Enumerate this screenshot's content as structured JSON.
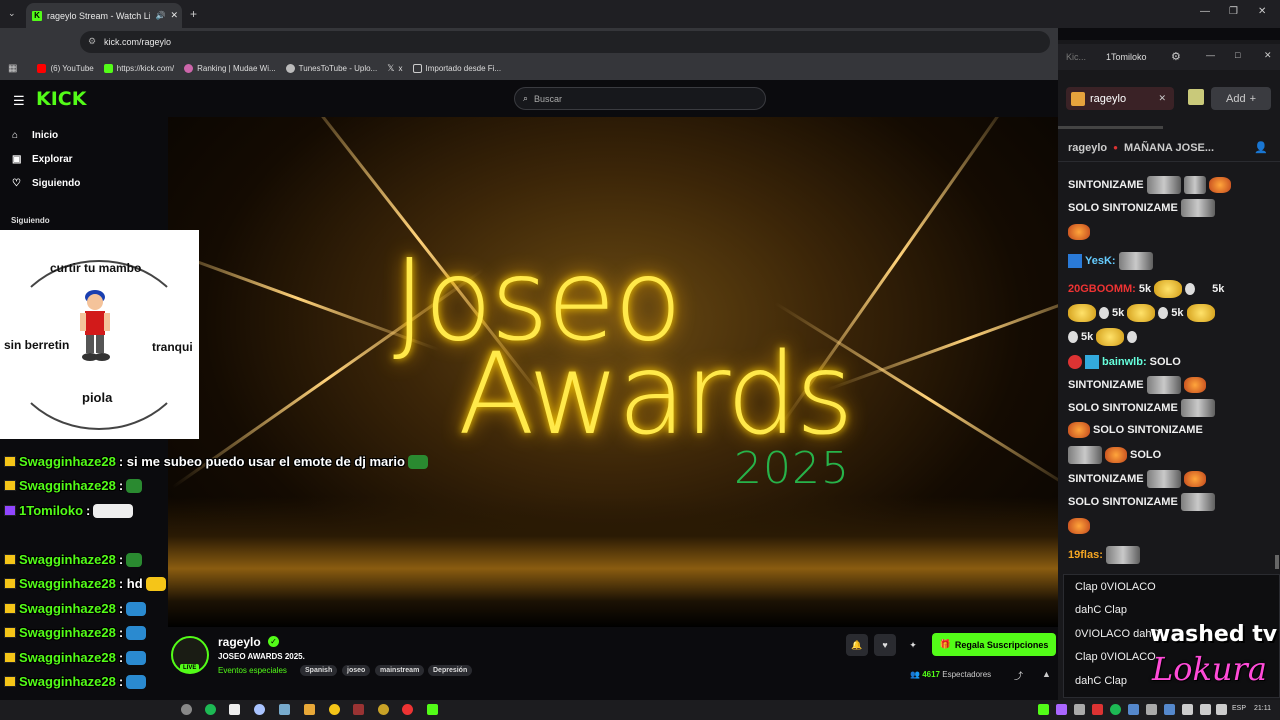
{
  "browser": {
    "tab_title": "rageylo Stream - Watch Liv",
    "url": "kick.com/rageylo",
    "bookmarks": [
      "(6) YouTube",
      "https://kick.com/",
      "Ranking | Mudae Wi...",
      "TunesToTube - Uplo...",
      "x",
      "Importado desde Fi..."
    ]
  },
  "kick": {
    "logo": "KICK",
    "search_placeholder": "Buscar",
    "nav": [
      "Inicio",
      "Explorar",
      "Siguiendo"
    ],
    "following_title": "Siguiendo"
  },
  "video": {
    "title_line1": "Joseo",
    "title_line2": "Awards",
    "year": "2025"
  },
  "mambo": {
    "top": "curtir tu mambo",
    "left": "sin berretin",
    "right": "tranqui",
    "bottom": "piola"
  },
  "overlay_chat": [
    {
      "user": "Swagginhaze28",
      "text": ": si me subeo puedo usar el emote de dj mario"
    },
    {
      "user": "Swagginhaze28",
      "text": ":"
    },
    {
      "user": "1Tomiloko",
      "text": ":"
    },
    {
      "user": "Swagginhaze28",
      "text": ":"
    },
    {
      "user": "Swagginhaze28",
      "text": ": hd"
    },
    {
      "user": "Swagginhaze28",
      "text": ":"
    },
    {
      "user": "Swagginhaze28",
      "text": ":"
    },
    {
      "user": "Swagginhaze28",
      "text": ":"
    },
    {
      "user": "Swagginhaze28",
      "text": ":"
    },
    {
      "user": "Swagginhaze28",
      "text": ":"
    }
  ],
  "stream": {
    "streamer": "rageylo",
    "title": "JOSEO AWARDS 2025.",
    "category": "Eventos especiales",
    "tags": [
      "Spanish",
      "joseo",
      "mainstream",
      "Depresión"
    ],
    "live_label": "LIVE",
    "subscribe_label": "Regala Suscripciones",
    "viewers_count": "4617",
    "viewers_label": "Espectadores"
  },
  "right_panel": {
    "window_title": "1Tomiloko",
    "channel_tab": "rageylo",
    "add_label": "Add",
    "header_user": "rageylo",
    "header_title": "MAÑANA JOSE...",
    "messages": [
      {
        "text": "SINTONIZAME"
      },
      {
        "text": "SOLO SINTONIZAME"
      },
      {
        "user": "YesK:",
        "text": ""
      },
      {
        "user": "20GBOOMM:",
        "text": "5k"
      },
      {
        "text": "5k"
      },
      {
        "text": "5k"
      },
      {
        "text": "5k"
      },
      {
        "user": "bainwlb:",
        "text": "SOLO"
      },
      {
        "text": "SINTONIZAME"
      },
      {
        "text": "SOLO SINTONIZAME"
      },
      {
        "text": "SOLO SINTONIZAME"
      },
      {
        "text": "SOLO"
      },
      {
        "text": "SINTONIZAME"
      },
      {
        "text": "SOLO SINTONIZAME"
      },
      {
        "user": "19flas:",
        "text": ""
      }
    ],
    "popup": [
      "Clap 0VIOLACO",
      "dahC  Clap",
      "0VIOLACO  dahC",
      "Clap 0VIOLACO",
      "dahC  Clap"
    ],
    "overlay_brand_1": "washed tv",
    "overlay_brand_2": "Lokura"
  },
  "taskbar": {
    "lang": "ESP",
    "clock": "21:11"
  },
  "colors": {
    "kick_green": "#53fc18",
    "glow_yellow": "#ffe94a",
    "year_green": "#27b34a",
    "lokura_pink": "#ff4bd8"
  }
}
